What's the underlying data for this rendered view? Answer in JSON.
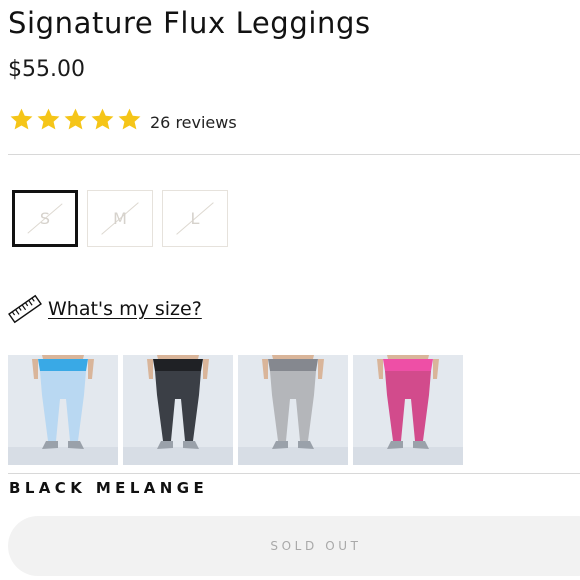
{
  "product": {
    "title": "Signature Flux Leggings",
    "price": "$55.00",
    "rating": {
      "stars": 5,
      "max_stars": 5,
      "reviews_label": "26 reviews",
      "star_color": "#f5c518"
    }
  },
  "sizes": {
    "options": [
      {
        "label": "S",
        "selected": true,
        "available": false
      },
      {
        "label": "M",
        "selected": false,
        "available": false
      },
      {
        "label": "L",
        "selected": false,
        "available": false
      }
    ]
  },
  "size_guide": {
    "label": "What's my size?",
    "icon": "ruler-icon"
  },
  "colors": {
    "swatches": [
      {
        "name": "light-blue",
        "legging_color": "#b9d8f2",
        "waist_color": "#39a9e6"
      },
      {
        "name": "black-melange",
        "legging_color": "#3b3f46",
        "waist_color": "#1f2125"
      },
      {
        "name": "grey",
        "legging_color": "#b4b6ba",
        "waist_color": "#85888f"
      },
      {
        "name": "pink",
        "legging_color": "#d24b8c",
        "waist_color": "#ee4fa6"
      }
    ],
    "selected_label": "BLACK MELANGE"
  },
  "cart": {
    "button_label": "SOLD OUT"
  }
}
